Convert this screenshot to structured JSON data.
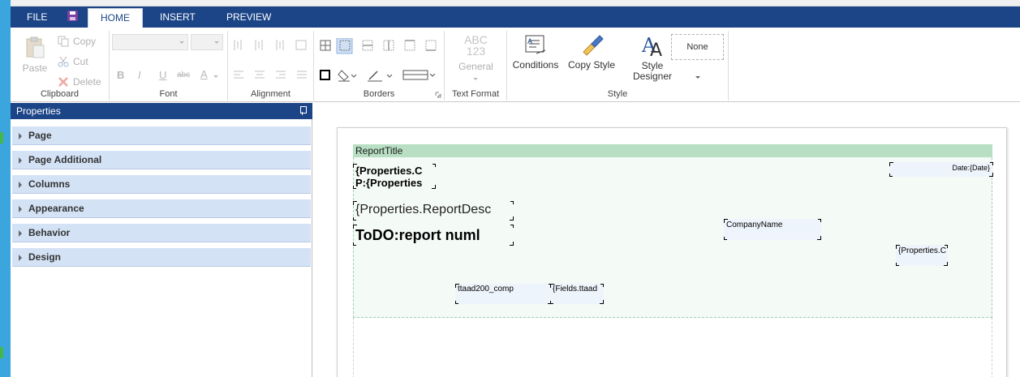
{
  "menu": {
    "tabs": [
      {
        "label": "FILE"
      },
      {
        "label": "HOME",
        "active": true
      },
      {
        "label": "INSERT"
      },
      {
        "label": "PREVIEW"
      }
    ],
    "save_icon": "save-icon"
  },
  "ribbon": {
    "clipboard": {
      "label": "Clipboard",
      "paste": "Paste",
      "copy": "Copy",
      "cut": "Cut",
      "delete": "Delete"
    },
    "font": {
      "label": "Font",
      "bold": "B",
      "italic": "I",
      "underline": "U",
      "strikethrough": "abc",
      "color": "A"
    },
    "alignment": {
      "label": "Alignment"
    },
    "borders": {
      "label": "Borders"
    },
    "text_format": {
      "label": "Text Format",
      "preview_line1": "ABC",
      "preview_line2": "123",
      "value": "General"
    },
    "style": {
      "label": "Style",
      "conditions": "Conditions",
      "copy_style": "Copy Style",
      "style_designer_line1": "Style",
      "style_designer_line2": "Designer",
      "current_style": "None"
    }
  },
  "properties": {
    "title": "Properties",
    "categories": [
      {
        "label": "Page"
      },
      {
        "label": "Page Additional"
      },
      {
        "label": "Columns"
      },
      {
        "label": "Appearance"
      },
      {
        "label": "Behavior"
      },
      {
        "label": "Design"
      }
    ]
  },
  "report": {
    "band_title": "ReportTitle",
    "components": {
      "prop_c_line1": "{Properties.C",
      "prop_c_line2": "P:{Properties",
      "report_desc": "{Properties.ReportDesc",
      "report_number": "ToDO:report numl",
      "date": "Date:{Date}",
      "company_name": "CompanyName",
      "prop_c_right": "{Properties.C",
      "ttaad_comp": "ttaad200_comp",
      "fields_ttaad": "{Fields.ttaad"
    }
  },
  "colors": {
    "menubar": "#1c4587",
    "band_header": "#b8dfc3",
    "prop_category": "#d4e2f6"
  }
}
